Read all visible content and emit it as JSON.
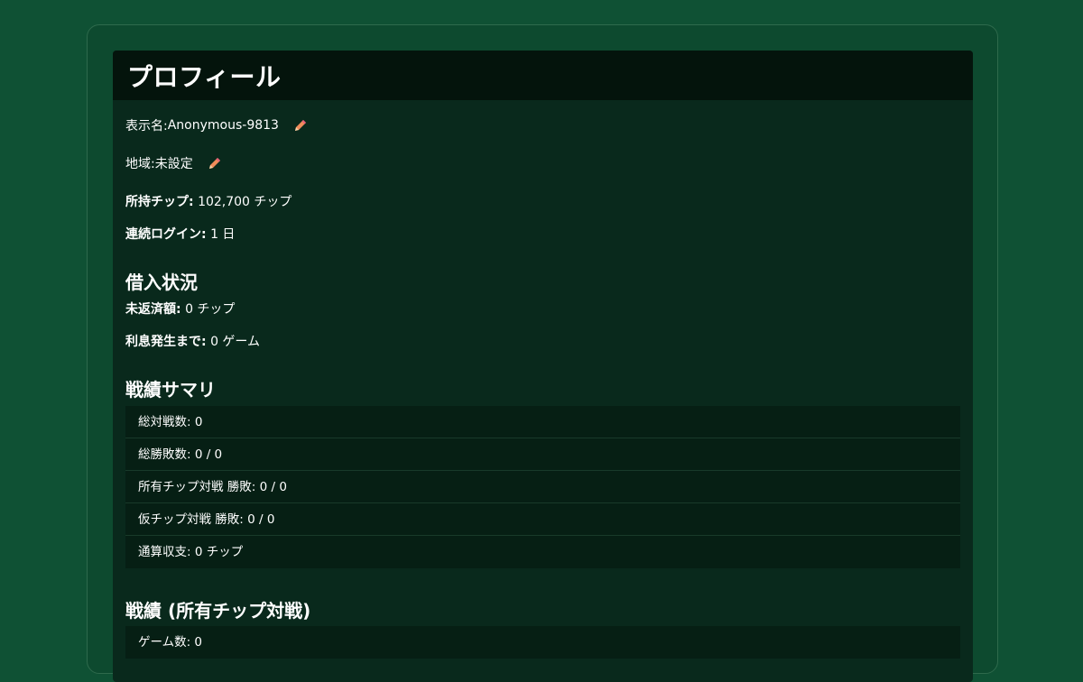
{
  "profile": {
    "title": "プロフィール",
    "display_name_label": "表示名:",
    "display_name_value": "Anonymous-9813",
    "region_label": "地域:",
    "region_value": "未設定",
    "chips_label": "所持チップ:",
    "chips_value": "102,700 チップ",
    "login_label": "連続ログイン:",
    "login_value": "1 日"
  },
  "loan": {
    "heading": "借入状況",
    "outstanding_label": "未返済額:",
    "outstanding_value": "0 チップ",
    "interest_label": "利息発生まで:",
    "interest_value": "0 ゲーム"
  },
  "summary": {
    "heading": "戦績サマリ",
    "items": [
      "総対戦数: 0",
      "総勝敗数: 0 / 0",
      "所有チップ対戦 勝敗: 0 / 0",
      "仮チップ対戦 勝敗: 0 / 0",
      "通算収支: 0 チップ"
    ]
  },
  "owned_record": {
    "heading": "戦績 (所有チップ対戦)",
    "items": [
      "ゲーム数: 0"
    ]
  },
  "icons": {
    "edit": "pencil-icon"
  },
  "colors": {
    "background": "#0f5134",
    "panel": "#09291c",
    "header": "#04140c",
    "pencil": "#f08c5a"
  }
}
